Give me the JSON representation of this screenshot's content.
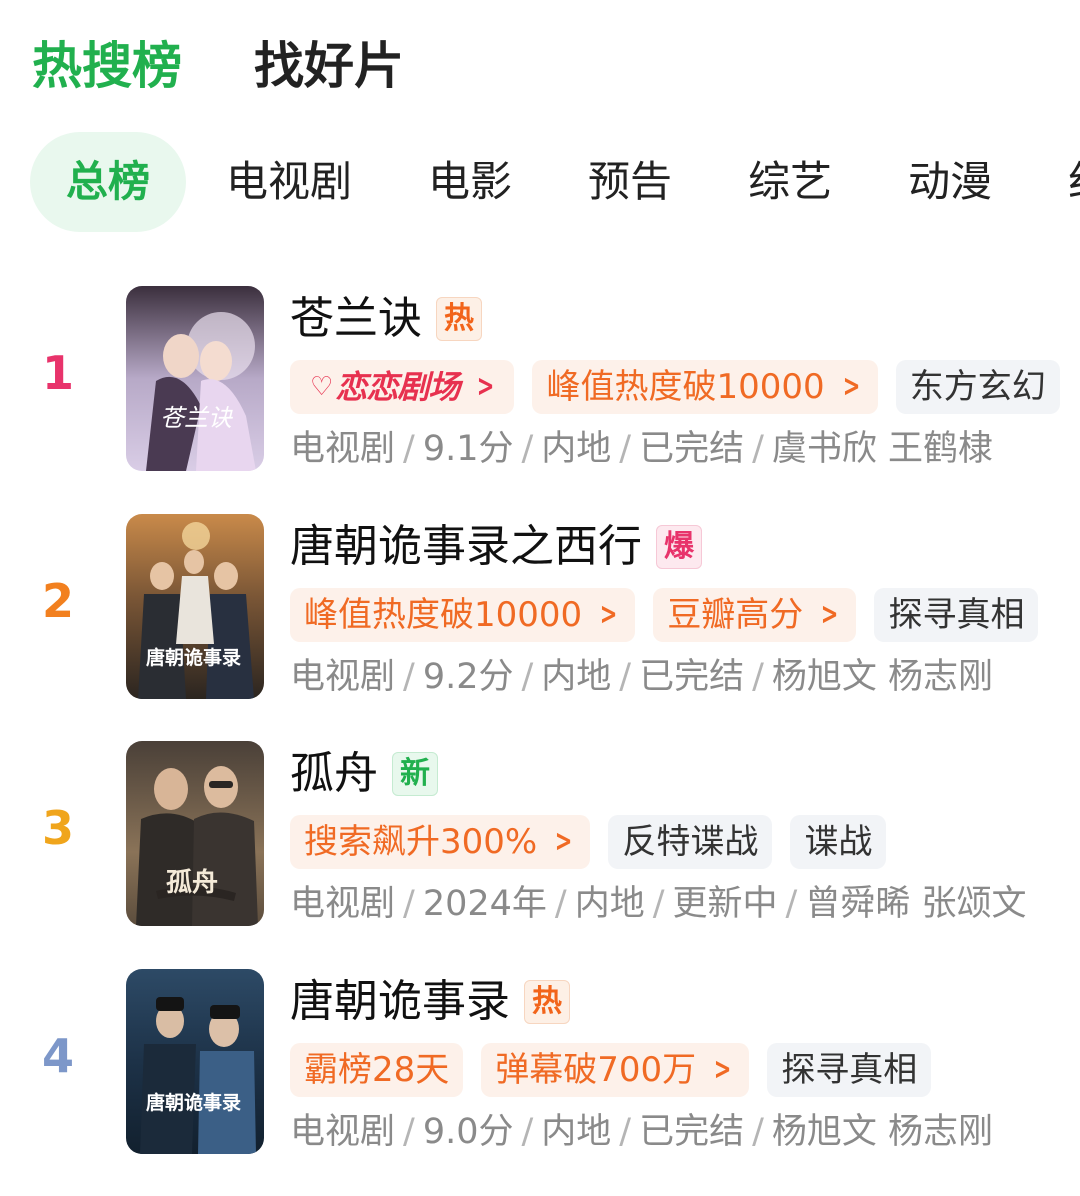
{
  "top_tabs": [
    {
      "label": "热搜榜",
      "active": true
    },
    {
      "label": "找好片",
      "active": false
    }
  ],
  "category_tabs": [
    {
      "label": "总榜",
      "active": true
    },
    {
      "label": "电视剧"
    },
    {
      "label": "电影"
    },
    {
      "label": "预告"
    },
    {
      "label": "综艺"
    },
    {
      "label": "动漫"
    },
    {
      "label": "纪"
    }
  ],
  "items": [
    {
      "rank": "1",
      "rank_color": "#e8336b",
      "title": "苍兰诀",
      "badge": "热",
      "badge_type": "hot",
      "brand_tag": {
        "logo": "恋恋剧场",
        "sub": "LOVE"
      },
      "tags": [
        {
          "label": "峰值热度破10000",
          "style": "orange",
          "arrow": true
        },
        {
          "label": "东方玄幻",
          "style": "gray",
          "arrow": false
        }
      ],
      "meta": [
        "电视剧",
        "9.1分",
        "内地",
        "已完结",
        "虞书欣 王鹤棣"
      ],
      "poster_icon": "poster-canglanjue",
      "poster_text": "苍兰诀"
    },
    {
      "rank": "2",
      "rank_color": "#f2801f",
      "title": "唐朝诡事录之西行",
      "badge": "爆",
      "badge_type": "boom",
      "tags": [
        {
          "label": "峰值热度破10000",
          "style": "orange",
          "arrow": true
        },
        {
          "label": "豆瓣高分",
          "style": "orange",
          "arrow": true
        },
        {
          "label": "探寻真相",
          "style": "gray",
          "arrow": false
        }
      ],
      "meta": [
        "电视剧",
        "9.2分",
        "内地",
        "已完结",
        "杨旭文 杨志刚"
      ],
      "poster_icon": "poster-tangchao-xixing",
      "poster_text": "唐朝诡事录"
    },
    {
      "rank": "3",
      "rank_color": "#f0a51c",
      "title": "孤舟",
      "badge": "新",
      "badge_type": "new",
      "tags": [
        {
          "label": "搜索飙升300%",
          "style": "orange",
          "arrow": true
        },
        {
          "label": "反特谍战",
          "style": "gray",
          "arrow": false
        },
        {
          "label": "谍战",
          "style": "gray",
          "arrow": false
        }
      ],
      "meta": [
        "电视剧",
        "2024年",
        "内地",
        "更新中",
        "曾舜晞 张颂文"
      ],
      "poster_icon": "poster-guzhou",
      "poster_text": "孤舟"
    },
    {
      "rank": "4",
      "rank_color": "#7d97c9",
      "title": "唐朝诡事录",
      "badge": "热",
      "badge_type": "hot",
      "tags": [
        {
          "label": "霸榜28天",
          "style": "orange",
          "arrow": false
        },
        {
          "label": "弹幕破700万",
          "style": "orange",
          "arrow": true
        },
        {
          "label": "探寻真相",
          "style": "gray",
          "arrow": false
        }
      ],
      "meta": [
        "电视剧",
        "9.0分",
        "内地",
        "已完结",
        "杨旭文 杨志刚"
      ],
      "poster_icon": "poster-tangchao",
      "poster_text": "唐朝诡事录"
    }
  ]
}
